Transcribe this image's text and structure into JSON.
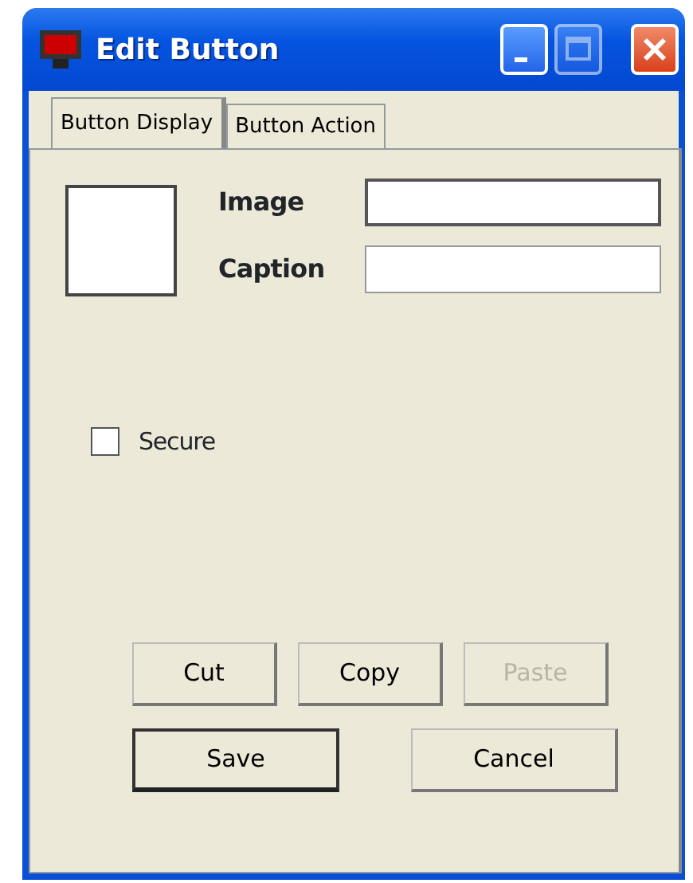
{
  "window": {
    "title": "Edit Button",
    "controls": [
      {
        "kind": "minimize",
        "disabled": false
      },
      {
        "kind": "maximize",
        "disabled": true
      },
      {
        "kind": "close",
        "disabled": false
      }
    ]
  },
  "tabs": [
    {
      "label": "Button Display",
      "selected": true
    },
    {
      "label": "Button Action",
      "selected": false
    }
  ],
  "fields": [
    {
      "label": "Image",
      "focused": true
    },
    {
      "label": "Caption",
      "focused": false
    }
  ],
  "secure": {
    "label": "Secure",
    "checked": false
  },
  "edit_buttons": [
    {
      "label": "Cut",
      "disabled": false
    },
    {
      "label": "Copy",
      "disabled": false
    },
    {
      "label": "Paste",
      "disabled": true
    }
  ],
  "dialog_buttons": [
    {
      "label": "Save",
      "default": true
    },
    {
      "label": "Cancel",
      "default": false
    }
  ]
}
